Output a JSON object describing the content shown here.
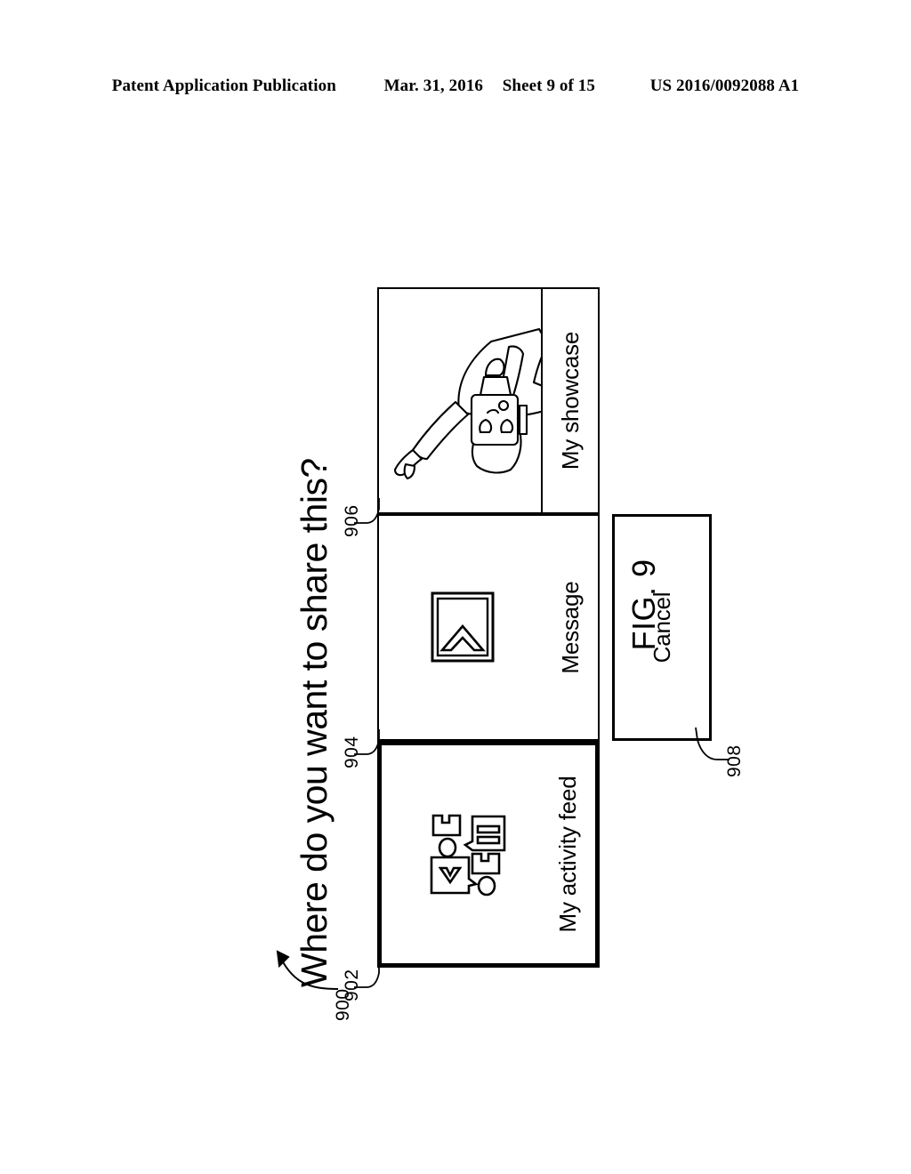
{
  "header": {
    "publication": "Patent Application Publication",
    "date": "Mar. 31, 2016",
    "sheet": "Sheet 9 of 15",
    "patent_number": "US 2016/0092088 A1"
  },
  "figure": {
    "caption": "FIG. 9",
    "reference_numeral": "900"
  },
  "dialog": {
    "title": "Where do you want to share this?",
    "options": [
      {
        "label": "My activity feed",
        "reference_numeral": "902",
        "icon": "activity-feed-icon",
        "selected": true
      },
      {
        "label": "Message",
        "reference_numeral": "904",
        "icon": "envelope-icon",
        "selected": false
      },
      {
        "label": "My showcase",
        "reference_numeral": "906",
        "icon": "person-pointing-illustration",
        "selected": false
      }
    ],
    "cancel": {
      "label": "Cancel",
      "reference_numeral": "908"
    }
  },
  "colors": {
    "ink": "#000000",
    "paper": "#ffffff"
  }
}
